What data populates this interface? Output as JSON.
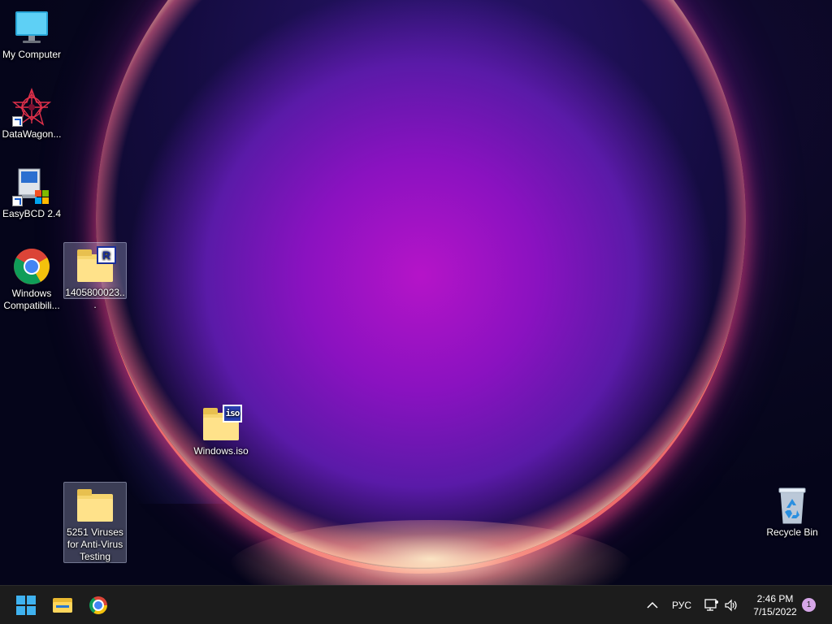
{
  "desktop": {
    "icons": [
      {
        "label": "My Computer",
        "icon": "monitor-icon"
      },
      {
        "label": "DataWagon...",
        "icon": "datawagon-icon"
      },
      {
        "label": "EasyBCD 2.4",
        "icon": "easybcd-icon"
      },
      {
        "label": "Windows Compatibili...",
        "icon": "chrome-icon"
      },
      {
        "label": "1405800023...",
        "icon": "folder-r-icon",
        "badge": "R"
      },
      {
        "label": "Windows.iso",
        "icon": "iso-file-icon",
        "badge": "iso"
      },
      {
        "label": "5251 Viruses for Anti-Virus Testing",
        "icon": "folder-icon"
      },
      {
        "label": "Recycle Bin",
        "icon": "recycle-bin-icon"
      }
    ]
  },
  "taskbar": {
    "start": "start-icon",
    "pinned": [
      "file-explorer-icon",
      "chrome-icon"
    ],
    "tray": {
      "language": "РУС",
      "time": "2:46 PM",
      "date": "7/15/2022",
      "notification_count": "1"
    }
  },
  "colors": {
    "taskbar_bg": "#1c1c1c",
    "accent": "#3fb2f0",
    "notification_badge": "#d6a6e8"
  }
}
